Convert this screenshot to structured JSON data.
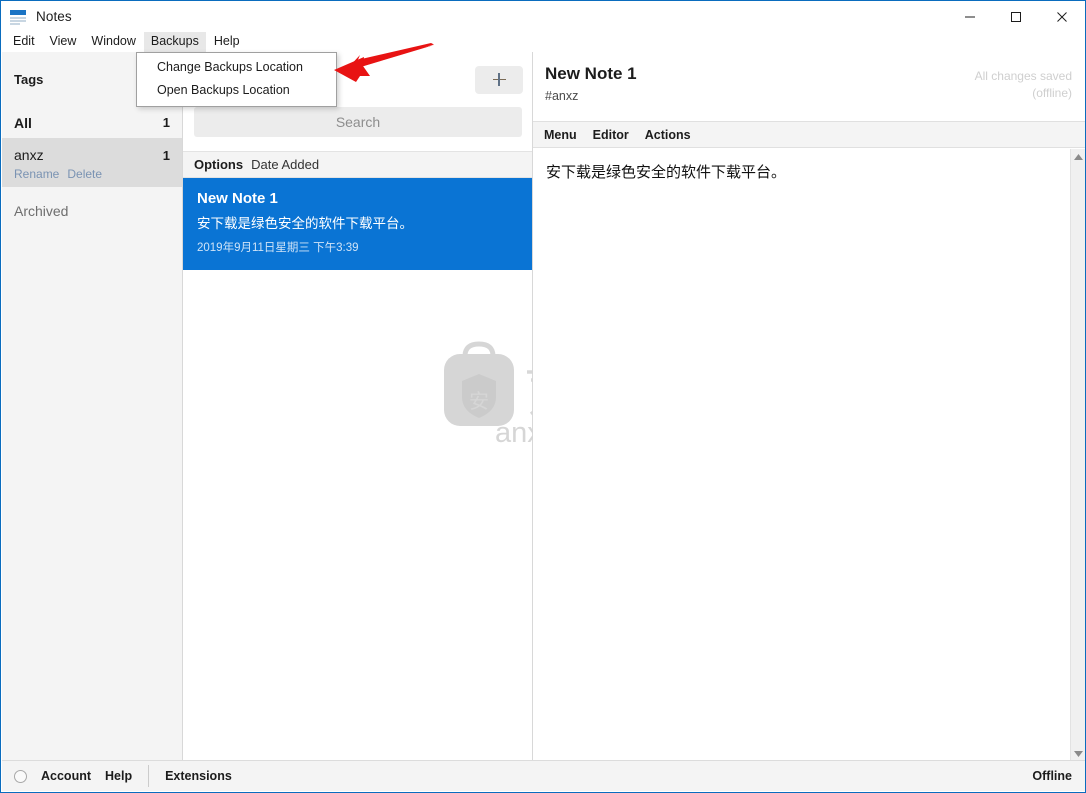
{
  "window": {
    "title": "Notes",
    "icon": "notes-app-icon",
    "controls": {
      "minimize": "minimize-icon",
      "maximize": "maximize-icon",
      "close": "close-icon"
    }
  },
  "menubar": {
    "items": [
      {
        "label": "Edit",
        "active": false
      },
      {
        "label": "View",
        "active": false
      },
      {
        "label": "Window",
        "active": false
      },
      {
        "label": "Backups",
        "active": true
      },
      {
        "label": "Help",
        "active": false
      }
    ]
  },
  "dropdown": {
    "open_for": "Backups",
    "items": [
      {
        "label": "Change Backups Location"
      },
      {
        "label": "Open Backups Location"
      }
    ]
  },
  "annotation": {
    "type": "arrow",
    "color": "#e81313",
    "points_to": "Change Backups Location"
  },
  "sidebar": {
    "header": "Tags",
    "tags": [
      {
        "label": "All",
        "count": "1",
        "selected": false,
        "actions": []
      },
      {
        "label": "anxz",
        "count": "1",
        "selected": true,
        "actions": [
          "Rename",
          "Delete"
        ]
      }
    ],
    "archived": {
      "label": "Archived"
    }
  },
  "notelist": {
    "add_button": "+",
    "search": {
      "placeholder": "Search",
      "value": ""
    },
    "sortbar": {
      "options_label": "Options",
      "sort_value": "Date Added"
    },
    "notes": [
      {
        "title": "New Note 1",
        "preview": "安下载是绿色安全的软件下载平台。",
        "date": "2019年9月11日星期三 下午3:39",
        "selected": true
      }
    ],
    "watermark": {
      "cn": "安下载",
      "domain": "anxz.com",
      "shield_char": "安"
    }
  },
  "editor": {
    "title": "New Note 1",
    "tag": "#anxz",
    "save_status_line1": "All changes saved",
    "save_status_line2": "(offline)",
    "menu": [
      {
        "label": "Menu"
      },
      {
        "label": "Editor"
      },
      {
        "label": "Actions"
      }
    ],
    "body": "安下载是绿色安全的软件下载平台。"
  },
  "statusbar": {
    "account": "Account",
    "help": "Help",
    "extensions": "Extensions",
    "connection": "Offline"
  },
  "colors": {
    "accent": "#0a74d4",
    "window_border": "#0a6cbe",
    "sidebar_bg": "#f4f4f4",
    "selected_tag_bg": "#dcdcdc",
    "link_blue": "#7a93b3",
    "annotation_red": "#e81313"
  }
}
